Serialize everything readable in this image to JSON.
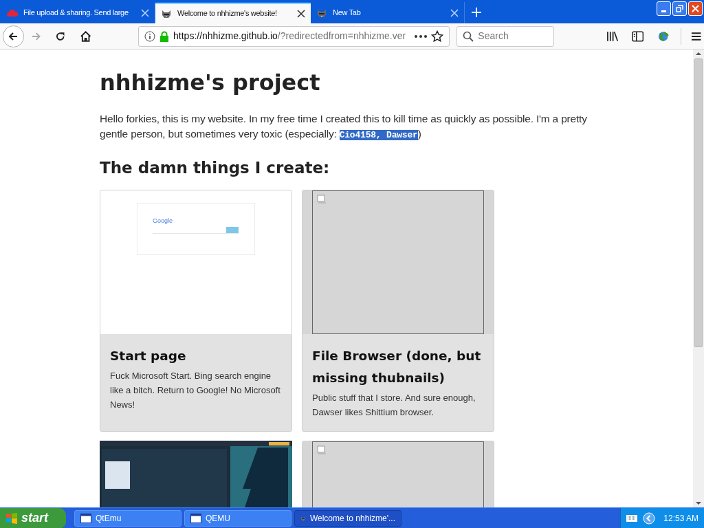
{
  "tabs": [
    {
      "title": "File upload & sharing. Send large",
      "selected": false,
      "kind": "cloud"
    },
    {
      "title": "Welcome to nhhizme's website!",
      "selected": true,
      "kind": "raccoon"
    },
    {
      "title": "New Tab",
      "selected": false,
      "kind": "raccoon"
    }
  ],
  "toolbar": {
    "url_host": "https://nhhizme.github.io",
    "url_rest": "/?redirectedfrom=nhhizme.ver",
    "search_placeholder": "Search"
  },
  "page": {
    "heading": "nhhizme's project",
    "intro": {
      "before": "Hello forkies, this is my website. In my free time I created this to kill time as quickly as possible. I'm a pretty gentle person, but sometimes very toxic (especially: ",
      "code": "Cio4158, Dawser",
      "code_selected": true,
      "after": ")"
    },
    "subheading": "The damn things I create:",
    "cards": [
      {
        "kind": "google",
        "thumb_text": "Google",
        "title": "Start page",
        "text": "Fuck Microsoft Start. Bing search engine like a bitch. Return to Google! No Microsoft News!"
      },
      {
        "kind": "missing",
        "title": "File Browser (done, but missing thubnails)",
        "text": "Public stuff that I store. And sure enough, Dawser likes Shittium browser."
      },
      {
        "kind": "picture"
      },
      {
        "kind": "missing"
      }
    ]
  },
  "taskbar": {
    "start": "start",
    "items": [
      {
        "label": "QtEmu",
        "selected": false,
        "kind": "window"
      },
      {
        "label": "QEMU",
        "selected": false,
        "kind": "window"
      },
      {
        "label": "Welcome to nhhizme'...",
        "selected": true,
        "kind": "raccoon"
      }
    ],
    "clock": "12:53 AM"
  }
}
